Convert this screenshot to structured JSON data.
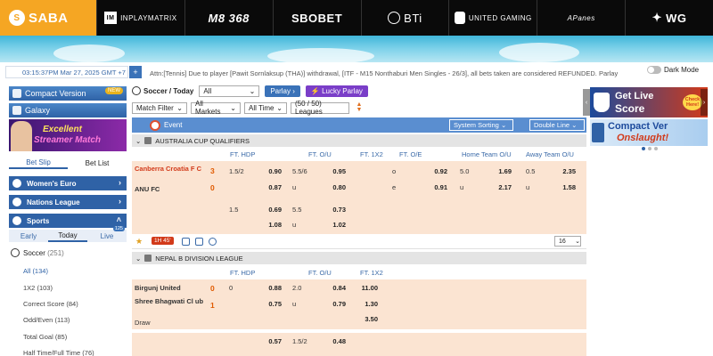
{
  "providers": [
    {
      "label": "SABA",
      "icon": "saba-logo-icon"
    },
    {
      "label": "INPLAYMATRIX",
      "icon": "inplaymatrix-logo-icon"
    },
    {
      "label": "M8 368",
      "icon": "m8-logo-icon"
    },
    {
      "label": "SBOBET",
      "icon": "sbobet-logo-icon"
    },
    {
      "label": "BTi",
      "icon": "bti-logo-icon"
    },
    {
      "label": "UNITED GAMING",
      "icon": "united-gaming-logo-icon"
    },
    {
      "label": "APanes",
      "icon": "apanes-logo-icon"
    },
    {
      "label": "WG",
      "icon": "wg-logo-icon"
    }
  ],
  "timebar": {
    "text": "03:15:37PM Mar 27, 2025 GMT +7",
    "button": "+"
  },
  "ticker": "Attn:[Tennis] Due to player [Pawit Sornlaksup (THA)] withdrawal, [ITF - M15 Nonthaburi Men Singles - 26/3], all bets taken are considered REFUNDED. Parlay",
  "dark_mode": "Dark Mode",
  "side": {
    "compact": "Compact Version",
    "compact_badge": "NEW",
    "galaxy": "Galaxy",
    "promo_l1": "Excellent",
    "promo_l2": "Streamer Match",
    "tab_betslip": "Bet Slip",
    "tab_betlist": "Bet List",
    "womens_euro": "Women's Euro",
    "nations_league": "Nations League",
    "sports": "Sports",
    "early": "Early",
    "today": "Today",
    "live": "Live",
    "live_count": "125",
    "soccer": "Soccer",
    "soccer_count": "(251)",
    "menu": [
      {
        "label": "All",
        "count": "(134)"
      },
      {
        "label": "1X2",
        "count": "(103)"
      },
      {
        "label": "Correct Score",
        "count": "(84)"
      },
      {
        "label": "Odd/Even",
        "count": "(113)"
      },
      {
        "label": "Total Goal",
        "count": "(85)"
      },
      {
        "label": "Half Time/Full Time",
        "count": "(76)"
      }
    ]
  },
  "main": {
    "title": "Soccer / Today",
    "all_select": "All",
    "parlay": "Parlay",
    "lucky_parlay": "Lucky Parlay",
    "match_filter": "Match Filter",
    "all_markets": "All Markets",
    "all_time": "All Time",
    "leagues": "(50 / 50) Leagues",
    "event": "Event",
    "system_sorting": "System Sorting",
    "double_line": "Double Line"
  },
  "league1": {
    "name": "AUSTRALIA CUP QUALIFIERS",
    "cols": [
      "FT. HDP",
      "FT. O/U",
      "FT. 1X2",
      "FT. O/E",
      "Home Team O/U",
      "Away Team O/U"
    ],
    "home": "Canberra Croatia F C",
    "away": "ANU FC",
    "home_score": "3",
    "away_score": "0",
    "row1": {
      "hdp": "1.5/2",
      "hdp_h": "0.90",
      "hdp_a": "0.87",
      "ou": "5.5/6",
      "ou_o": "0.95",
      "ou_u": "0.80",
      "oe_o_lbl": "o",
      "oe_o": "0.92",
      "oe_e_lbl": "e",
      "oe_e": "0.91",
      "hou": "5.0",
      "hou_o": "1.69",
      "hou_u_lbl": "u",
      "hou_u": "2.17",
      "aou": "0.5",
      "aou_o": "2.35",
      "aou_u_lbl": "u",
      "aou_u": "1.58"
    },
    "row2": {
      "hdp": "1.5",
      "hdp_h": "0.69",
      "hdp_a": "1.08",
      "ou": "5.5",
      "ou_o": "0.73",
      "ou_u_lbl": "u",
      "ou_u": "1.02"
    },
    "ou_u_lbl": "u",
    "live_time": "1H 45'",
    "more": "16"
  },
  "league2": {
    "name": "NEPAL B DIVISION LEAGUE",
    "cols": [
      "FT. HDP",
      "FT. O/U",
      "FT. 1X2"
    ],
    "home": "Birgunj United",
    "away": "Shree Bhagwati Cl ub",
    "draw": "Draw",
    "home_score": "0",
    "away_score": "1",
    "row1": {
      "hdp": "0",
      "hdp_h": "0.88",
      "hdp_a": "0.75",
      "ou": "2.0",
      "ou_o": "0.84",
      "ou_u_lbl": "u",
      "ou_u": "0.79",
      "x1": "11.00",
      "x2": "1.30",
      "xd": "3.50"
    },
    "row2": {
      "hdp_h": "0.57",
      "ou": "1.5/2",
      "ou_o": "0.48"
    }
  },
  "ads": {
    "ad1_l1": "Get Live",
    "ad1_l2": "Score",
    "ad1_badge": "Check Here!",
    "ad2_l1": "Compact Ver",
    "ad2_l2": "Onslaught!"
  }
}
